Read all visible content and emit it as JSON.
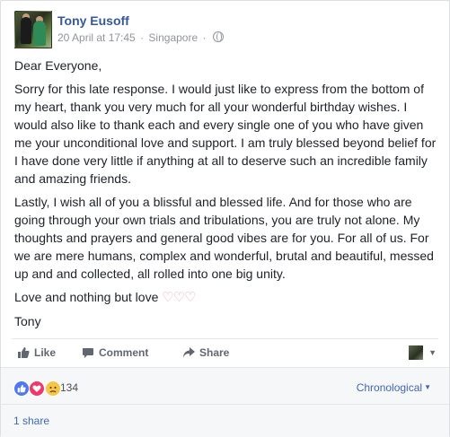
{
  "post": {
    "author": "Tony Eusoff",
    "date": "20 April at 17:45",
    "separator": "·",
    "location": "Singapore",
    "separator2": "·",
    "privacy_icon": "globe-icon"
  },
  "body": {
    "greeting": "Dear Everyone,",
    "paragraph1": "Sorry for this late response. I would just like to express from the bottom of my heart, thank you very much for all your wonderful birthday wishes. I would also like to thank each and every single one of you who have given me your unconditional love and support. I am truly blessed beyond belief for I have done very little if anything at all to deserve such an incredible family and amazing friends.",
    "paragraph2": "Lastly, I wish all of you a blissful and blessed life. And for those who are going through your own trials and tribulations, you are truly not alone. My thoughts and prayers and general good vibes are for you. For all of us. For we are mere humans, complex and wonderful, brutal and beautiful, messed up and and collected, all rolled into one big unity.",
    "closing": "Love and nothing but love",
    "hearts": "♡♡♡",
    "signature": "Tony"
  },
  "actions": {
    "like": "Like",
    "comment": "Comment",
    "share": "Share"
  },
  "reactions": {
    "count": "134",
    "types": [
      "like",
      "love",
      "sad"
    ],
    "sort_label": "Chronological"
  },
  "shares": {
    "label": "1 share"
  },
  "colors": {
    "link": "#365899",
    "meta": "#90949c",
    "action": "#606770",
    "like_reaction": "#4d78f0",
    "love_reaction": "#f0386b",
    "sad_reaction": "#f7c544"
  }
}
